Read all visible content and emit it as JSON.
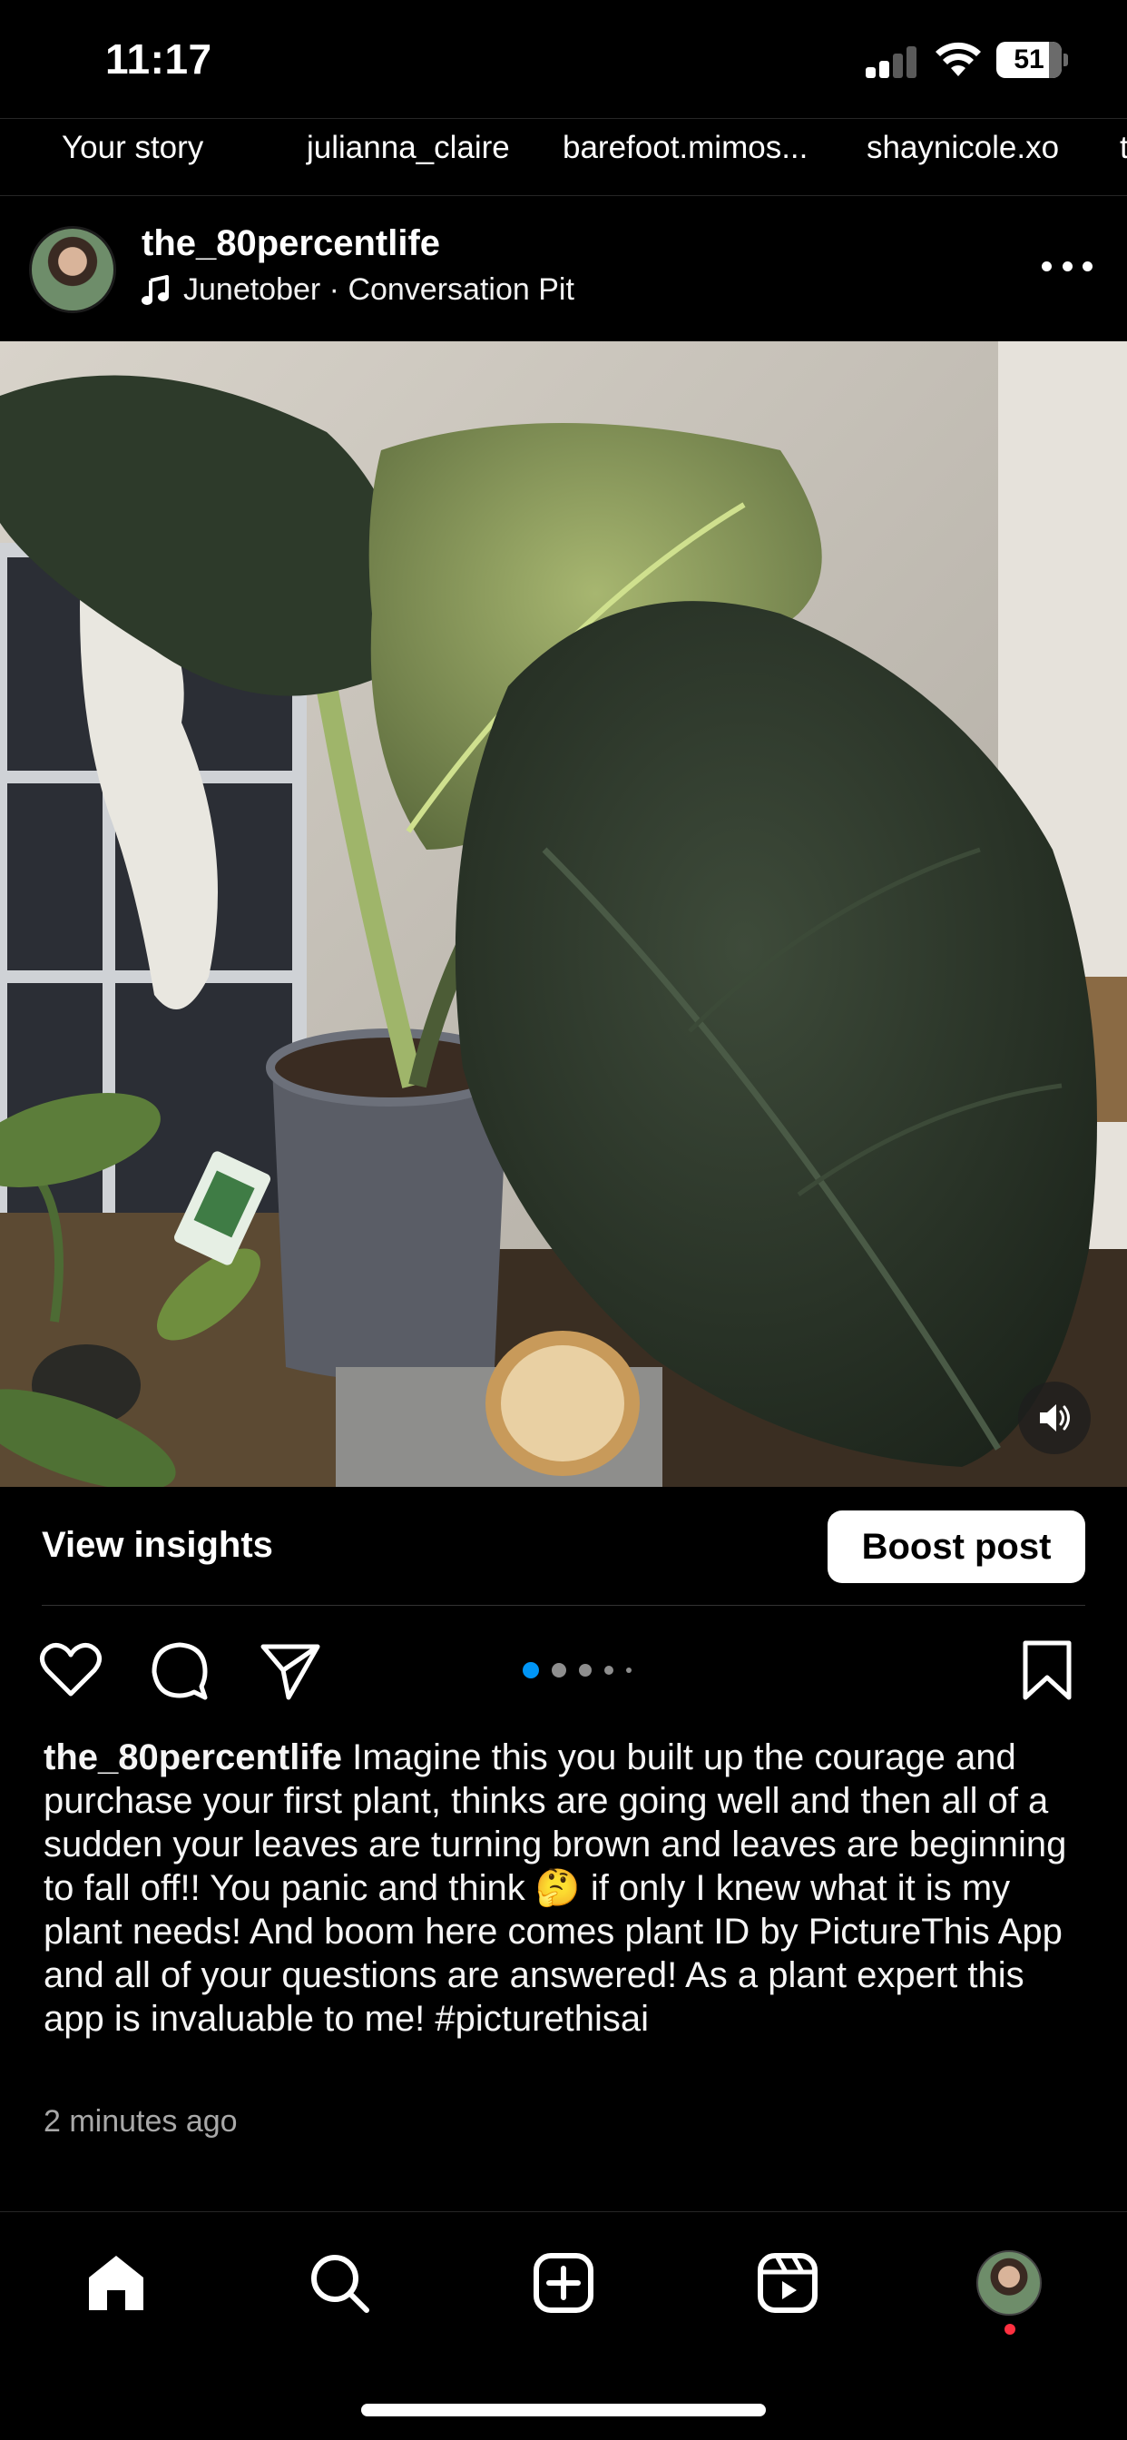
{
  "status_bar": {
    "time": "11:17",
    "battery": "51"
  },
  "stories": [
    "Your story",
    "julianna_claire",
    "barefoot.mimos...",
    "shaynicole.xo",
    "t"
  ],
  "post": {
    "username": "the_80percentlife",
    "music": "Junetober · Conversation Pit",
    "media_icon": "sound-on-icon",
    "insights_label": "View insights",
    "boost_label": "Boost post",
    "carousel": {
      "total_dots": 5,
      "active_index": 0,
      "active_color": "#0095f6"
    },
    "caption_username": "the_80percentlife",
    "caption_text": " Imagine this you built up the courage and purchase your first plant, thinks are going well and then all of a sudden your leaves are turning brown and leaves are beginning to fall off!! You panic and think 🤔 if only I knew what it is my plant needs! And boom here comes plant ID by PictureThis App and all of your questions are answered! As a plant expert this app is invaluable to me!  #picturethisai",
    "timestamp": "2 minutes ago"
  },
  "tab_bar": {
    "items": [
      "home-icon",
      "search-icon",
      "create-icon",
      "reels-icon",
      "profile-avatar"
    ],
    "notification_color": "#ff3040"
  },
  "colors": {
    "background": "#000000",
    "text": "#ffffff",
    "secondary_text": "#a8a8a8",
    "accent": "#0095f6"
  }
}
